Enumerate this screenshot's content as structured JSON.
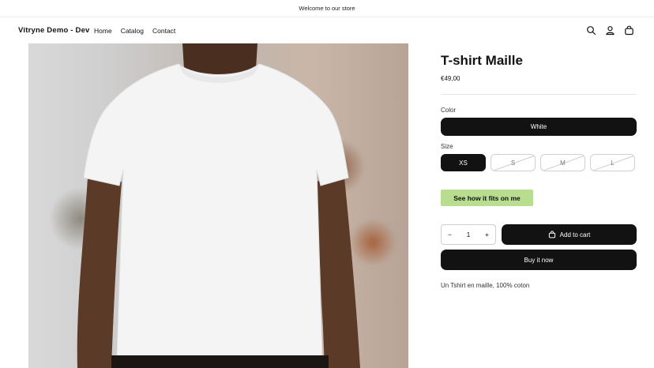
{
  "announcement": {
    "text": "Welcome to our store"
  },
  "header": {
    "brand": "Vitryne Demo - Dev",
    "nav": [
      "Home",
      "Catalog",
      "Contact"
    ],
    "icons": [
      "search-icon",
      "account-icon",
      "cart-icon"
    ]
  },
  "product": {
    "title": "T-shirt Maille",
    "price": "€49,00",
    "color_label": "Color",
    "color_value": "White",
    "size_label": "Size",
    "sizes": [
      {
        "label": "XS",
        "selected": true,
        "available": true
      },
      {
        "label": "S",
        "selected": false,
        "available": false
      },
      {
        "label": "M",
        "selected": false,
        "available": false
      },
      {
        "label": "L",
        "selected": false,
        "available": false
      }
    ],
    "fit_button": "See how it fits on me",
    "quantity": {
      "minus": "−",
      "value": "1",
      "plus": "+"
    },
    "add_to_cart": "Add to cart",
    "buy_now": "Buy it now",
    "description": "Un Tshirt en maille, 100% coton"
  },
  "colors": {
    "accent": "#121212",
    "fit_button_bg": "#b9dd8e"
  }
}
